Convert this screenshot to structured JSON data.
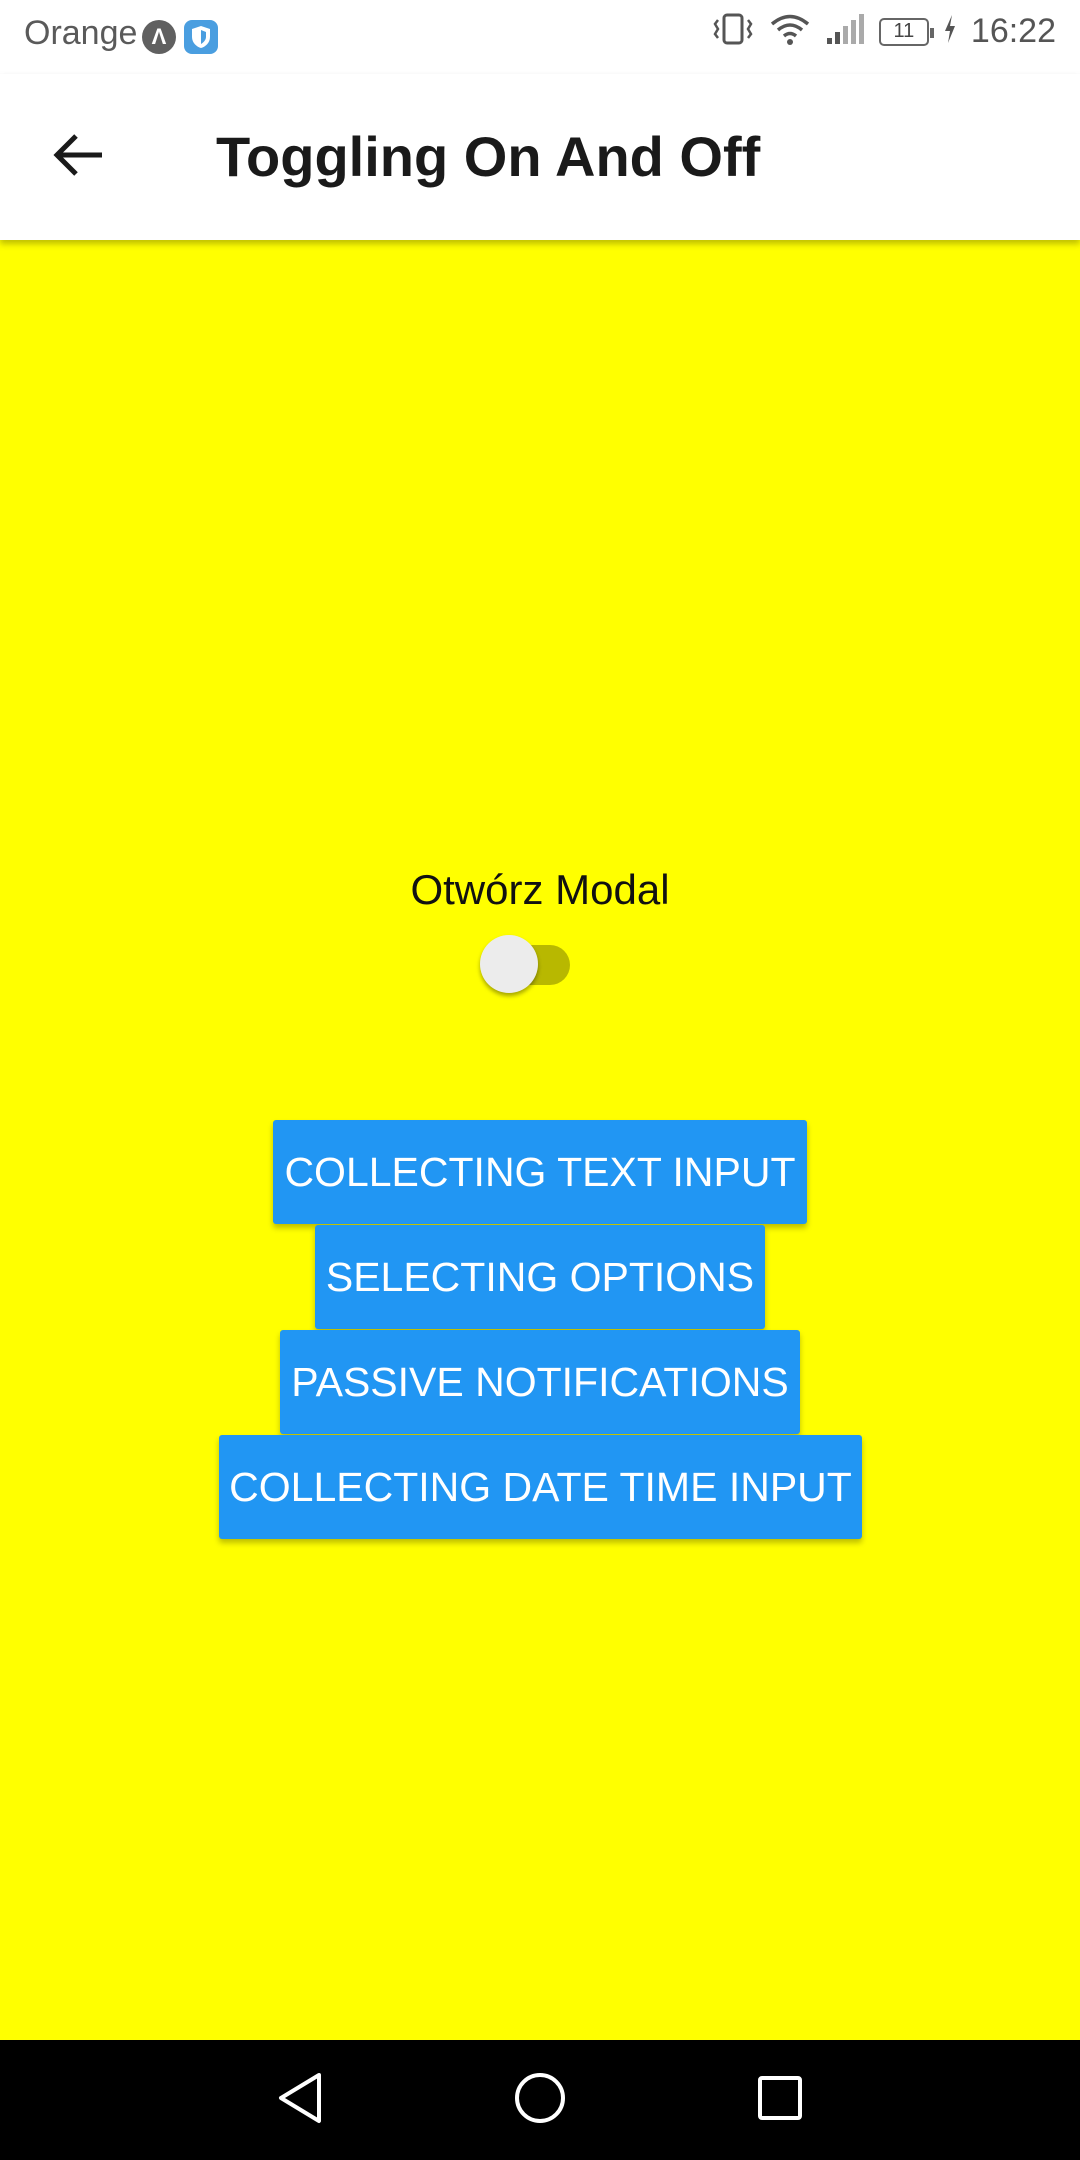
{
  "status_bar": {
    "carrier": "Orange",
    "battery_level": "11",
    "time": "16:22",
    "icons": [
      "app-notification-icon",
      "shield-icon",
      "vibrate-icon",
      "wifi-icon",
      "signal-icon",
      "battery-icon",
      "charging-icon"
    ]
  },
  "app_bar": {
    "title": "Toggling On And Off",
    "back_icon": "arrow-left-icon"
  },
  "content": {
    "background_color": "#ffff00",
    "toggle": {
      "label": "Otwórz Modal",
      "state": "off"
    },
    "buttons": [
      {
        "label": "COLLECTING TEXT INPUT"
      },
      {
        "label": "SELECTING OPTIONS"
      },
      {
        "label": "PASSIVE NOTIFICATIONS"
      },
      {
        "label": "COLLECTING DATE TIME INPUT"
      }
    ],
    "button_color": "#2196f3"
  },
  "nav_bar": {
    "icons": [
      "nav-back-icon",
      "nav-home-icon",
      "nav-recents-icon"
    ]
  }
}
